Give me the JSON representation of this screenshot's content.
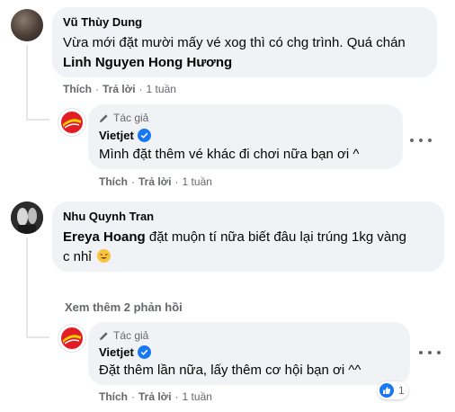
{
  "comments": [
    {
      "author": "Vũ Thùy Dung",
      "text": "Vừa mới đặt mười mấy vé xog thì có chg trình. Quá chán",
      "tag": "Linh Nguyen Hong Hương",
      "like_label": "Thích",
      "reply_label": "Trả lời",
      "time": "1 tuần",
      "reply": {
        "badge": "Tác giả",
        "author": "Vietjet",
        "text": "Mình đặt thêm vé khác đi chơi nữa bạn ơi ^",
        "like_label": "Thích",
        "reply_label": "Trả lời",
        "time": "1 tuần"
      }
    },
    {
      "author": "Nhu Quynh Tran",
      "tag": "Ereya Hoang",
      "text_line1": "đặt muộn tí nữa biết đâu lại trúng 1kg vàng",
      "text_line2": "c nhỉ",
      "emoji": "🤣",
      "see_more": "Xem thêm 2 phản hồi",
      "reply": {
        "badge": "Tác giả",
        "author": "Vietjet",
        "text": "Đặt thêm lần nữa, lấy thêm cơ hội bạn ơi ^^",
        "like_label": "Thích",
        "reply_label": "Trả lời",
        "time": "1 tuần",
        "reaction_count": "1"
      }
    }
  ],
  "colors": {
    "bubble": "#f0f2f5",
    "secondary_text": "#65676b",
    "verified": "#1877f2",
    "vietjet_red": "#e31d25",
    "vietjet_yellow": "#f9d100"
  }
}
